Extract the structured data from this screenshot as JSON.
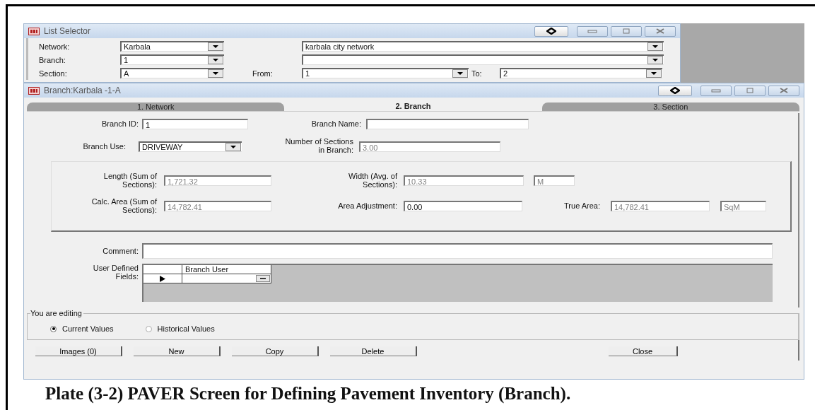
{
  "list_selector": {
    "title": "List Selector",
    "rows": [
      {
        "label": "Network:",
        "value": "Karbala",
        "extra_value": "karbala city network"
      },
      {
        "label": "Branch:",
        "value": "1"
      },
      {
        "label": "Section:",
        "value": "A",
        "from_label": "From:",
        "from_value": "1",
        "to_label": "To:",
        "to_value": "2"
      }
    ]
  },
  "branch_window": {
    "title": "Branch:Karbala -1-A",
    "tabs": [
      {
        "label": "1. Network",
        "selected": false
      },
      {
        "label": "2. Branch",
        "selected": true
      },
      {
        "label": "3. Section",
        "selected": false
      }
    ],
    "branch_id": {
      "label": "Branch ID:",
      "value": "1"
    },
    "branch_name": {
      "label": "Branch Name:"
    },
    "branch_use": {
      "label": "Branch Use:",
      "value": "DRIVEWAY"
    },
    "number_of_sections": {
      "label": "Number of Sections\nin Branch:",
      "value": "3.00",
      "disabled": true
    },
    "length": {
      "label": "Length (Sum of\nSections):",
      "value": "1,721.32",
      "disabled": true
    },
    "width": {
      "label": "Width (Avg. of\nSections):",
      "value": "10.33",
      "unit": "M",
      "disabled": true
    },
    "calc_area": {
      "label": "Calc. Area (Sum of\nSections):",
      "value": "14,782.41",
      "disabled": true
    },
    "area_adjustment": {
      "label": "Area Adjustment:",
      "value": "0.00",
      "disabled": false
    },
    "true_area": {
      "label": "True Area:",
      "value": "14,782.41",
      "unit": "SqM",
      "disabled": true
    },
    "comment": {
      "label": "Comment:"
    },
    "user_defined_fields": {
      "label": "User Defined\nFields:",
      "column": "Branch User"
    },
    "editing": {
      "legend": "You are editing",
      "options": [
        {
          "label": "Current Values",
          "selected": true
        },
        {
          "label": "Historical Values",
          "selected": false
        }
      ]
    },
    "buttons": [
      {
        "label": "Images (0)",
        "kind": "left"
      },
      {
        "label": "New",
        "kind": "left"
      },
      {
        "label": "Copy",
        "kind": "left"
      },
      {
        "label": "Delete",
        "kind": "left"
      },
      {
        "label": "Close",
        "kind": "right"
      }
    ]
  },
  "caption": "Plate (3-2) PAVER Screen for Defining Pavement Inventory (Branch)."
}
